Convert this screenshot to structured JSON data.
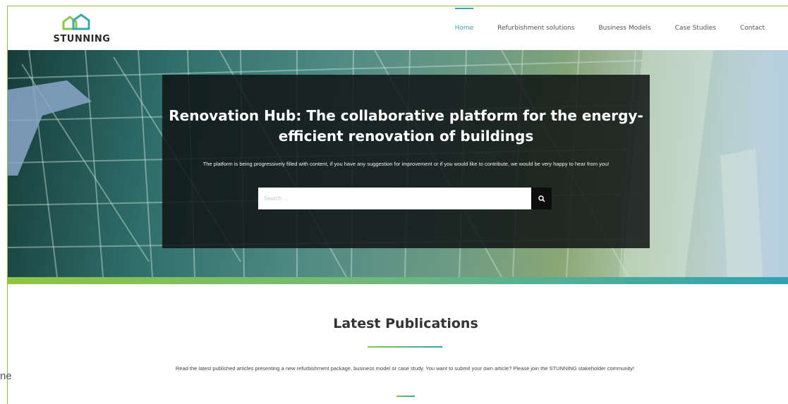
{
  "header": {
    "logo_text": "STUNNING",
    "nav": [
      {
        "label": "Home",
        "active": true
      },
      {
        "label": "Refurbishment solutions",
        "active": false
      },
      {
        "label": "Business Models",
        "active": false
      },
      {
        "label": "Case Studies",
        "active": false
      },
      {
        "label": "Contact",
        "active": false
      }
    ]
  },
  "hero": {
    "title": "Renovation Hub: The collaborative platform for the energy-efficient renovation of buildings",
    "subtitle": "The platform is being progressively filled with content, if you have any suggestion for improvement or if you would like to contribute, we would be very happy to hear from you!",
    "search_placeholder": "Search ...",
    "search_icon": "search-icon"
  },
  "publications": {
    "title": "Latest Publications",
    "description": "Read the latest published articles presenting a new refurbishment package, business model or case study. You want to submit your own article? Please join the STUNNING stakeholder community!"
  },
  "side_fragment": "ne",
  "colors": {
    "accent_teal": "#3aa8b0",
    "accent_green": "#8ec542",
    "overlay": "#0f1414"
  }
}
